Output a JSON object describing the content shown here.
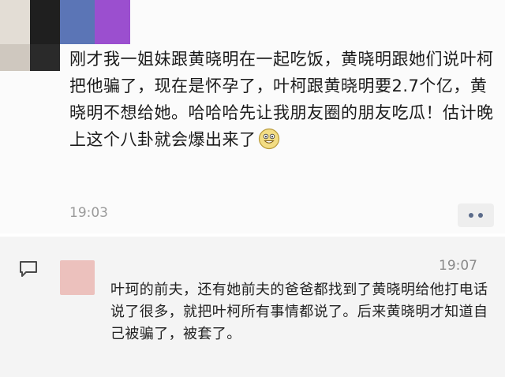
{
  "post": {
    "text": "刚才我一姐妹跟黄晓明在一起吃饭，黄晓明跟她们说叶柯把他骗了，现在是怀孕了，叶柯跟黄晓明要2.7个亿，黄晓明不想给她。哈哈哈先让我朋友圈的朋友吃瓜！估计晚上这个八卦就会爆出来了",
    "emoji_icon": "grinning-face-emoji",
    "time": "19:03",
    "more_icon": "more-dots-icon"
  },
  "avatar_colors": [
    "#d9d1c8",
    "#1f1f1f",
    "#5b75b6",
    "#9b4fcf",
    "#2a2a2a",
    "#c9c2b8"
  ],
  "comment": {
    "icon": "comment-bubble-icon",
    "time": "19:07",
    "avatar_color": "#ecc1bd",
    "text": "叶珂的前夫，还有她前夫的爸爸都找到了黄晓明给他打电话说了很多，就把叶柯所有事情都说了。后来黄晓明才知道自己被骗了，被套了。"
  }
}
